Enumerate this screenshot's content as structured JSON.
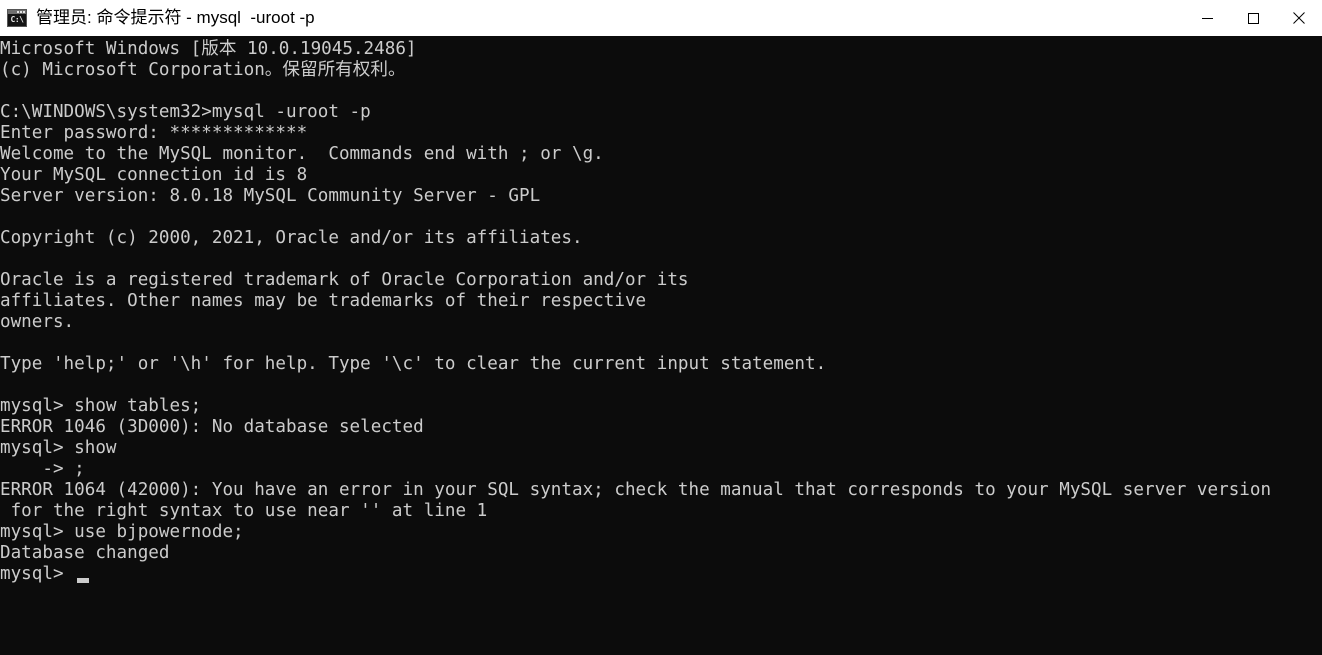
{
  "window": {
    "title": "管理员: 命令提示符 - mysql  -uroot -p",
    "icon": "cmd-console-icon",
    "icon_text": "C:\\",
    "titlebar_bg": "#ffffff",
    "titlebar_fg": "#000000",
    "controls": {
      "minimize": "minimize-button",
      "maximize": "maximize-button",
      "close": "close-button"
    }
  },
  "console": {
    "bg": "#0c0c0c",
    "fg": "#cccccc",
    "cursor": "▁",
    "lines": [
      "Microsoft Windows [版本 10.0.19045.2486]",
      "(c) Microsoft Corporation。保留所有权利。",
      "",
      "C:\\WINDOWS\\system32>mysql -uroot -p",
      "Enter password: *************",
      "Welcome to the MySQL monitor.  Commands end with ; or \\g.",
      "Your MySQL connection id is 8",
      "Server version: 8.0.18 MySQL Community Server - GPL",
      "",
      "Copyright (c) 2000, 2021, Oracle and/or its affiliates.",
      "",
      "Oracle is a registered trademark of Oracle Corporation and/or its",
      "affiliates. Other names may be trademarks of their respective",
      "owners.",
      "",
      "Type 'help;' or '\\h' for help. Type '\\c' to clear the current input statement.",
      "",
      "mysql> show tables;",
      "ERROR 1046 (3D000): No database selected",
      "mysql> show",
      "    -> ;",
      "ERROR 1064 (42000): You have an error in your SQL syntax; check the manual that corresponds to your MySQL server version",
      " for the right syntax to use near '' at line 1",
      "mysql> use bjpowernode;",
      "Database changed",
      "mysql> "
    ]
  }
}
